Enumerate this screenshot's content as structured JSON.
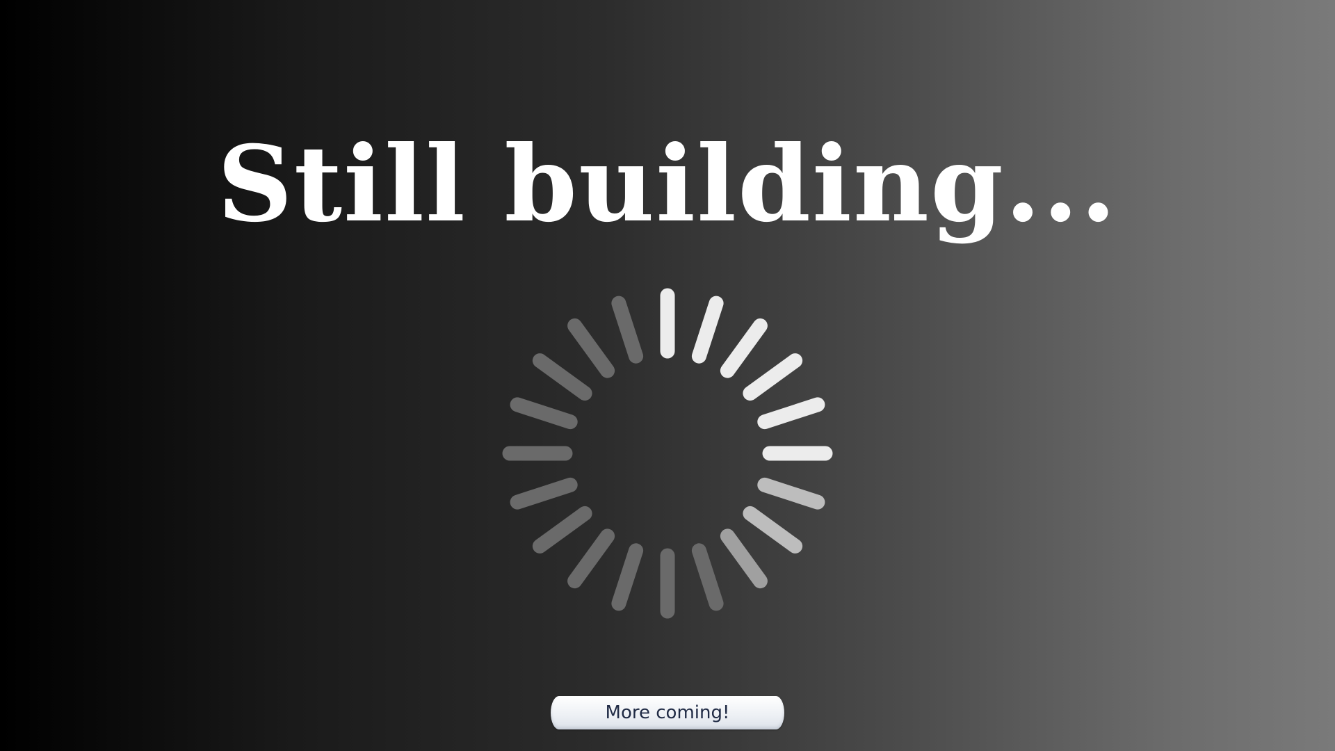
{
  "headline": "Still building...",
  "spinner": {
    "icon": "loading-spinner-icon",
    "spokes": 20,
    "active_color": "#ececec",
    "inactive_color": "#6a6a6a",
    "mid_color": "#bdbdbd"
  },
  "button": {
    "label": "More coming!"
  },
  "colors": {
    "headline": "#ffffff",
    "button_text": "#1f2a44"
  }
}
